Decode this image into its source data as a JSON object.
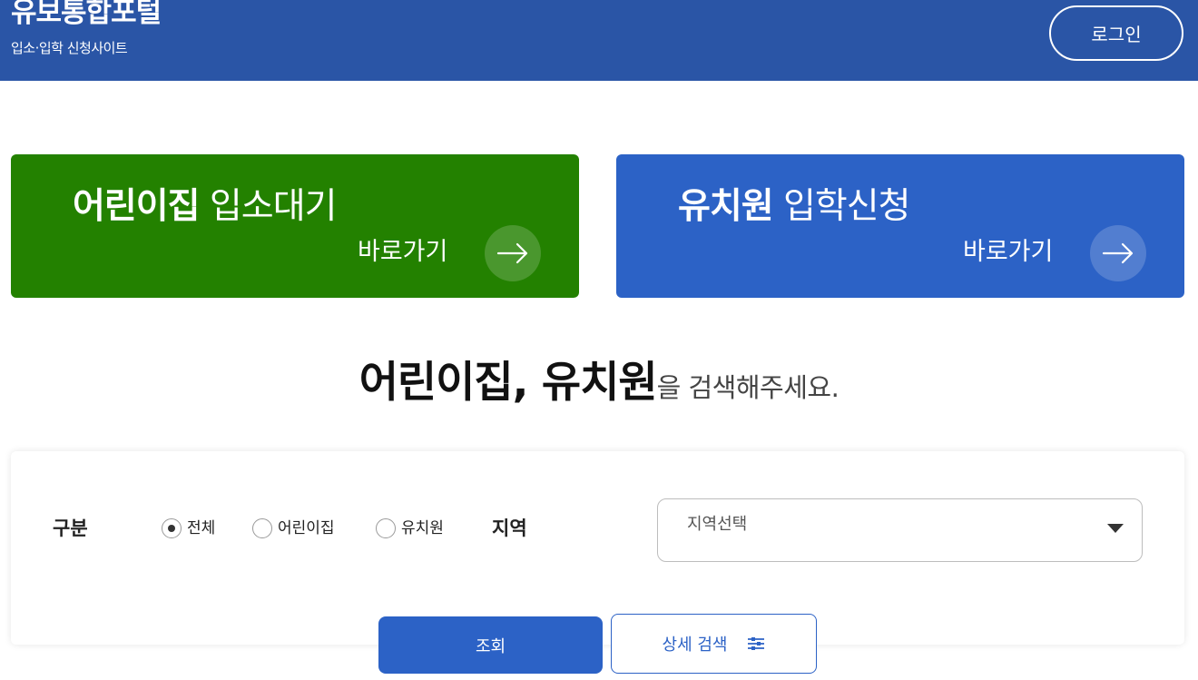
{
  "header": {
    "title": "유보통합포털",
    "subtitle": "입소·입학 신청사이트",
    "login_label": "로그인",
    "background": "#2a55a6"
  },
  "cards": [
    {
      "bold": "어린이집",
      "light": " 입소대기",
      "go_label": "바로가기",
      "icon": "arrow-right-icon",
      "color": "#238100"
    },
    {
      "bold": "유치원",
      "light": " 입학신청",
      "go_label": "바로가기",
      "icon": "arrow-right-icon",
      "color": "#2c62c6"
    }
  ],
  "search": {
    "headline_strong": "어린이집, 유치원",
    "headline_rest": "을 검색해주세요.",
    "type_label": "구분",
    "types": [
      {
        "label": "전체",
        "checked": true
      },
      {
        "label": "어린이집",
        "checked": false
      },
      {
        "label": "유치원",
        "checked": false
      }
    ],
    "region_label": "지역",
    "region_placeholder": "지역선택",
    "submit_label": "조회",
    "detail_label": "상세 검색",
    "detail_icon": "sliders-icon"
  }
}
